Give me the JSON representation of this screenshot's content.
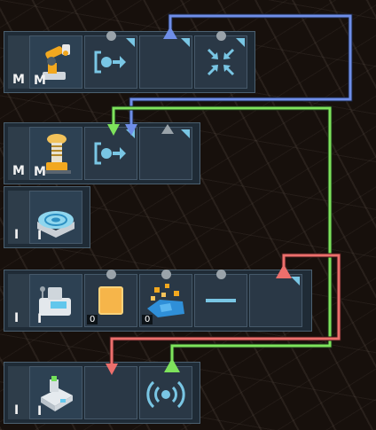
{
  "wire_colors": {
    "blue": "#6f8ee8",
    "green": "#7ee35c",
    "red": "#ec6f6c"
  },
  "accent_color": "#79c6e4",
  "machines": [
    {
      "icon": "robotic-arm-icon",
      "label_left": "M",
      "label_right": "M",
      "slots": [
        "output-arrow-icon",
        "empty",
        "merge-arrows-icon"
      ]
    },
    {
      "icon": "tesla-coil-icon",
      "label_left": "M",
      "label_right": "M",
      "slots": [
        "output-arrow-icon",
        "empty"
      ]
    },
    {
      "icon": "pressure-plate-icon",
      "label_left": "I",
      "label_right": "I",
      "slots": []
    },
    {
      "icon": "bioreactor-icon",
      "label_left": "I",
      "label_right": "I",
      "slots": [
        {
          "icon": "orange-cube-icon",
          "count": "0"
        },
        {
          "icon": "blue-blocks-icon",
          "count": "0"
        },
        "minus-icon",
        "empty"
      ]
    },
    {
      "icon": "sensor-module-icon",
      "label_left": "I",
      "label_right": "I",
      "slots": [
        "empty",
        "broadcast-signal-icon"
      ]
    }
  ]
}
